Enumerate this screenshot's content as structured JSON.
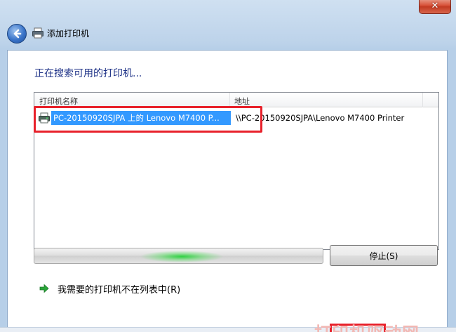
{
  "window": {
    "title": "添加打印机",
    "close_label": "✕"
  },
  "main": {
    "heading": "正在搜索可用的打印机...",
    "list": {
      "columns": [
        "打印机名称",
        "地址"
      ],
      "rows": [
        {
          "name": "PC-20150920SJPA 上的 Lenovo M7400 P...",
          "address": "\\\\PC-20150920SJPA\\Lenovo M7400 Printer",
          "icon": "printer-icon",
          "selected": true
        }
      ]
    },
    "progress": {
      "state": "indeterminate"
    },
    "stop_label": "停止(S)",
    "not_listed_link": "我需要的打印机不在列表中(R)"
  },
  "watermark": "打印机驱动网",
  "colors": {
    "selection": "#3399ff",
    "heading": "#1e3287",
    "highlight_box": "#e8212b",
    "progress_glow": "#28d23c"
  }
}
